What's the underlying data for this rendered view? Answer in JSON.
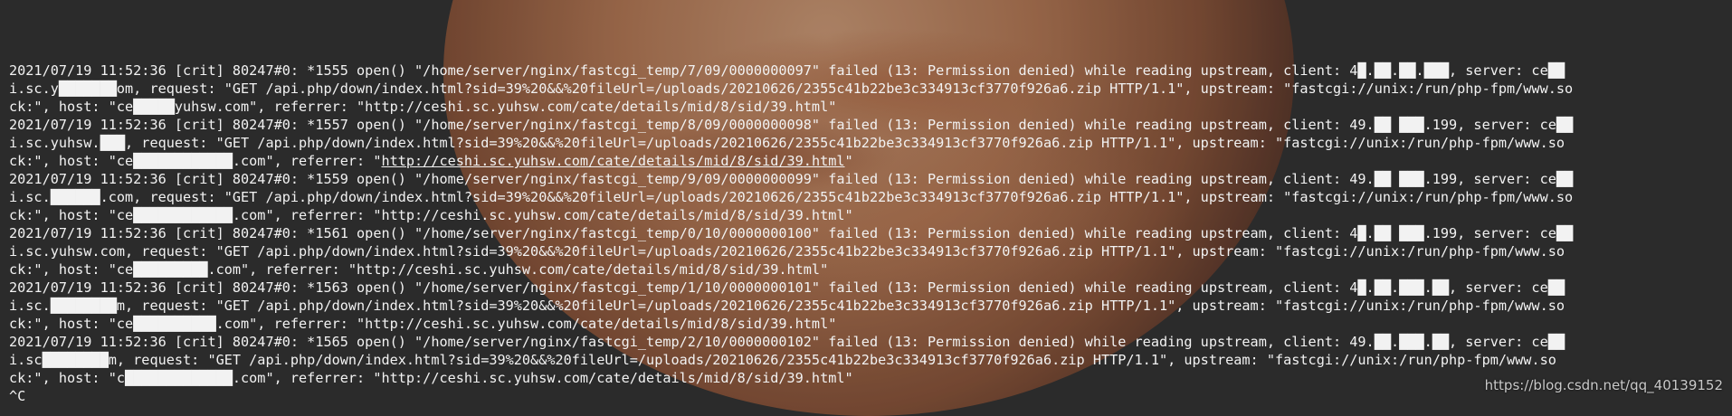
{
  "log": [
    {
      "line1": "2021/07/19 11:52:36 [crit] 80247#0: *1555 open() \"/home/server/nginx/fastcgi_temp/7/09/0000000097\" failed (13: Permission denied) while reading upstream, client: 4█.██.██.███, server: ce██",
      "line2": "i.sc.y███████om, request: \"GET /api.php/down/index.html?sid=39%20&&%20fileUrl=/uploads/20210626/2355c41b22be3c334913cf3770f926a6.zip HTTP/1.1\", upstream: \"fastcgi://unix:/run/php-fpm/www.so",
      "line3": "ck:\", host: \"ce█████yuhsw.com\", referrer: \"http://ceshi.sc.yuhsw.com/cate/details/mid/8/sid/39.html\""
    },
    {
      "line1": "2021/07/19 11:52:36 [crit] 80247#0: *1557 open() \"/home/server/nginx/fastcgi_temp/8/09/0000000098\" failed (13: Permission denied) while reading upstream, client: 49.██ ███.199, server: ce██",
      "line2": "i.sc.yuhsw.███, request: \"GET /api.php/down/index.html?sid=39%20&&%20fileUrl=/uploads/20210626/2355c41b22be3c334913cf3770f926a6.zip HTTP/1.1\", upstream: \"fastcgi://unix:/run/php-fpm/www.so",
      "line3_prefix": "ck:\", host: \"ce████████████.com\", referrer: \"",
      "line3_link": "http://ceshi.sc.yuhsw.com/cate/details/mid/8/sid/39.html",
      "line3_suffix": "\""
    },
    {
      "line1": "2021/07/19 11:52:36 [crit] 80247#0: *1559 open() \"/home/server/nginx/fastcgi_temp/9/09/0000000099\" failed (13: Permission denied) while reading upstream, client: 49.██ ███.199, server: ce██",
      "line2": "i.sc.██████.com, request: \"GET /api.php/down/index.html?sid=39%20&&%20fileUrl=/uploads/20210626/2355c41b22be3c334913cf3770f926a6.zip HTTP/1.1\", upstream: \"fastcgi://unix:/run/php-fpm/www.so",
      "line3": "ck:\", host: \"ce████████████.com\", referrer: \"http://ceshi.sc.yuhsw.com/cate/details/mid/8/sid/39.html\""
    },
    {
      "line1": "2021/07/19 11:52:36 [crit] 80247#0: *1561 open() \"/home/server/nginx/fastcgi_temp/0/10/0000000100\" failed (13: Permission denied) while reading upstream, client: 4█.██ ███.199, server: ce██",
      "line2": "i.sc.yuhsw.com, request: \"GET /api.php/down/index.html?sid=39%20&&%20fileUrl=/uploads/20210626/2355c41b22be3c334913cf3770f926a6.zip HTTP/1.1\", upstream: \"fastcgi://unix:/run/php-fpm/www.so",
      "line3": "ck:\", host: \"ce█████████.com\", referrer: \"http://ceshi.sc.yuhsw.com/cate/details/mid/8/sid/39.html\""
    },
    {
      "line1": "2021/07/19 11:52:36 [crit] 80247#0: *1563 open() \"/home/server/nginx/fastcgi_temp/1/10/0000000101\" failed (13: Permission denied) while reading upstream, client: 4█.██.███.██, server: ce██",
      "line2": "i.sc.████████m, request: \"GET /api.php/down/index.html?sid=39%20&&%20fileUrl=/uploads/20210626/2355c41b22be3c334913cf3770f926a6.zip HTTP/1.1\", upstream: \"fastcgi://unix:/run/php-fpm/www.so",
      "line3": "ck:\", host: \"ce██████████.com\", referrer: \"http://ceshi.sc.yuhsw.com/cate/details/mid/8/sid/39.html\""
    },
    {
      "line1": "2021/07/19 11:52:36 [crit] 80247#0: *1565 open() \"/home/server/nginx/fastcgi_temp/2/10/0000000102\" failed (13: Permission denied) while reading upstream, client: 49.██.███.██, server: ce██",
      "line2": "i.sc████████m, request: \"GET /api.php/down/index.html?sid=39%20&&%20fileUrl=/uploads/20210626/2355c41b22be3c334913cf3770f926a6.zip HTTP/1.1\", upstream: \"fastcgi://unix:/run/php-fpm/www.so",
      "line3": "ck:\", host: \"c█████████████.com\", referrer: \"http://ceshi.sc.yuhsw.com/cate/details/mid/8/sid/39.html\""
    }
  ],
  "prompt_text": "^C",
  "watermark": "https://blog.csdn.net/qq_40139152"
}
